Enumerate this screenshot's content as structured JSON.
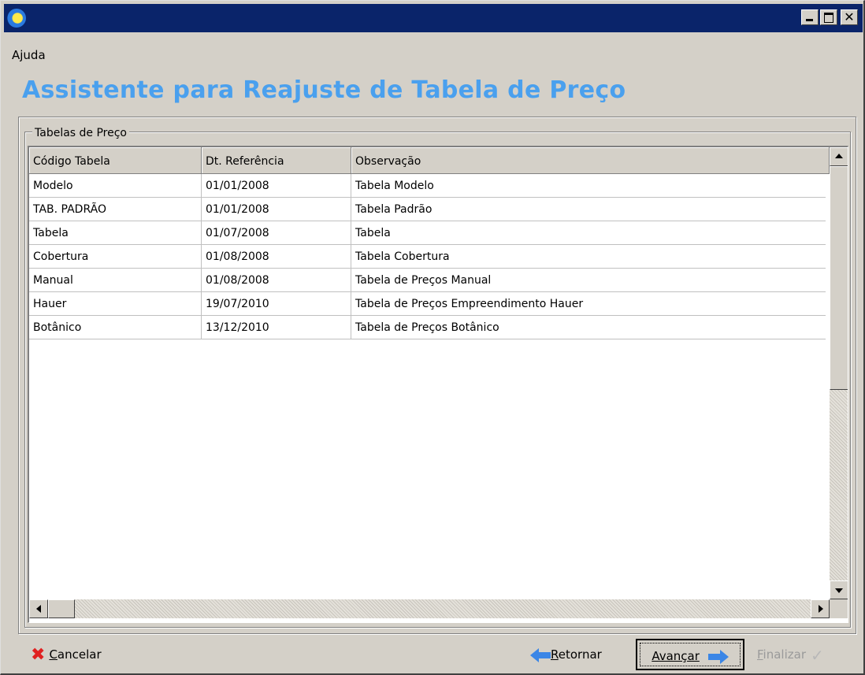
{
  "window": {
    "menu": [
      "Ajuda"
    ],
    "title_icon": "app-logo-icon"
  },
  "wizard": {
    "title": "Assistente para Reajuste de Tabela de Preço"
  },
  "group": {
    "label": "Tabelas de Preço"
  },
  "table": {
    "columns": [
      "Código Tabela",
      "Dt. Referência",
      "Observação"
    ],
    "rows": [
      [
        "Modelo",
        "01/01/2008",
        "Tabela Modelo"
      ],
      [
        "TAB. PADRÃO",
        "01/01/2008",
        "Tabela Padrão"
      ],
      [
        "Tabela",
        "01/07/2008",
        "Tabela"
      ],
      [
        "Cobertura",
        "01/08/2008",
        "Tabela Cobertura"
      ],
      [
        "Manual",
        "01/08/2008",
        "Tabela de Preços Manual"
      ],
      [
        "Hauer",
        "19/07/2010",
        "Tabela de Preços Empreendimento Hauer"
      ],
      [
        "Botânico",
        "13/12/2010",
        "Tabela de Preços Botânico"
      ]
    ]
  },
  "buttons": {
    "cancel": {
      "underline": "C",
      "rest": "ancelar",
      "icon": "red-x-icon"
    },
    "back": {
      "underline": "R",
      "rest": "etornar",
      "icon": "arrow-left-icon"
    },
    "next": {
      "underline": "A",
      "rest": "vançar",
      "icon": "arrow-right-icon"
    },
    "finish": {
      "underline": "F",
      "rest": "inalizar",
      "icon": "checkmark-icon",
      "enabled": false
    }
  },
  "colors": {
    "title_bar": "#0a246a",
    "wizard_title": "#4aa0ee",
    "arrow": "#3b86e6",
    "cancel_icon": "#e02020"
  }
}
